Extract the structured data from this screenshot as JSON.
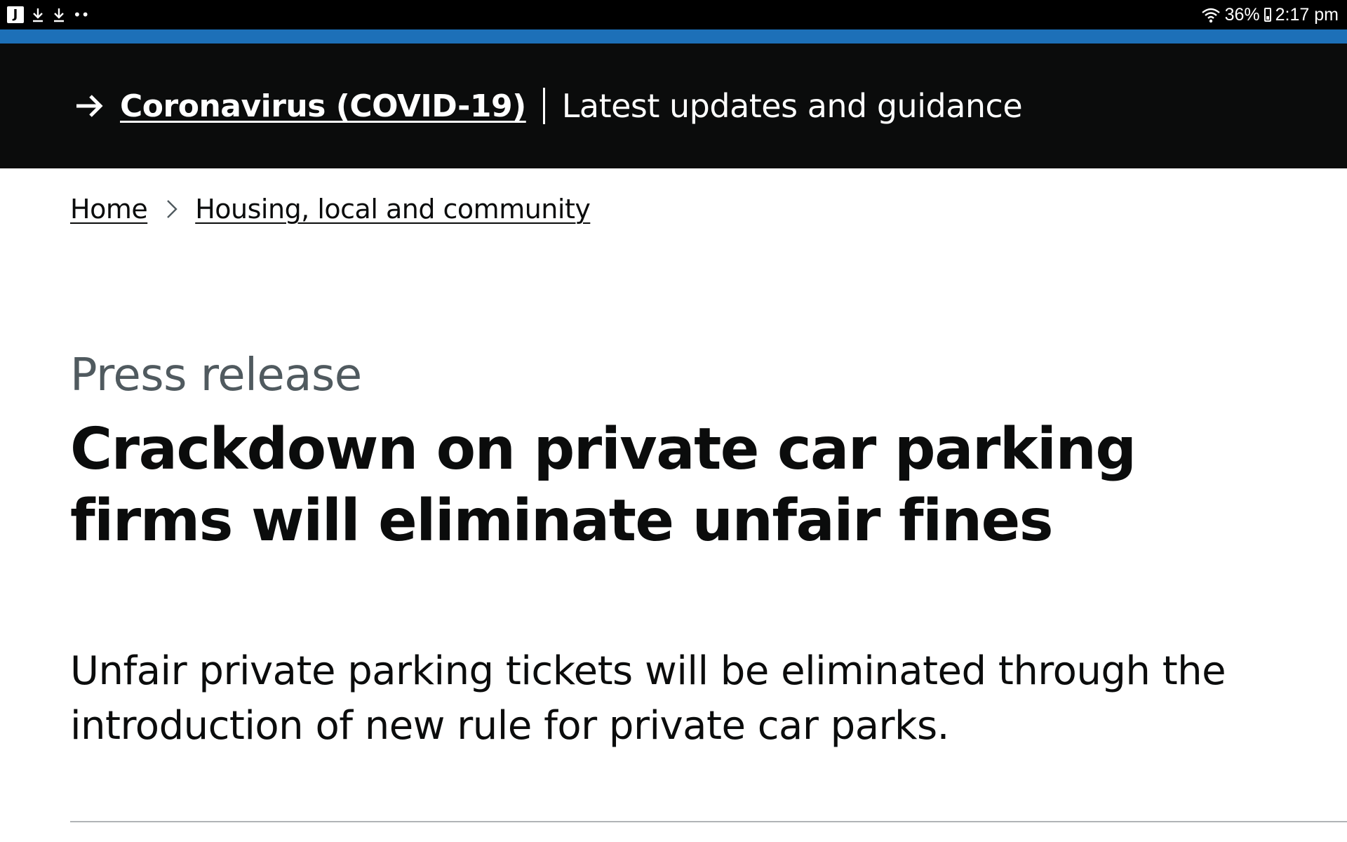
{
  "status_bar": {
    "app_icon_letter": "J",
    "notification_icons": [
      "download-icon",
      "download-icon"
    ],
    "more_dots": "••",
    "battery_percent": "36%",
    "time": "2:17 pm"
  },
  "covid_banner": {
    "link_label": "Coronavirus (COVID-19)",
    "subtitle": "Latest updates and guidance"
  },
  "breadcrumb": {
    "items": [
      "Home",
      "Housing, local and community"
    ]
  },
  "article": {
    "caption": "Press release",
    "title": "Crackdown on private car parking firms will eliminate unfair fines",
    "summary": "Unfair private parking tickets will be eliminated through the introduction of new rule for private car parks."
  },
  "colors": {
    "banner_bg": "#0b0c0c",
    "accent_blue": "#1d70b8",
    "caption_grey": "#505a5f"
  }
}
